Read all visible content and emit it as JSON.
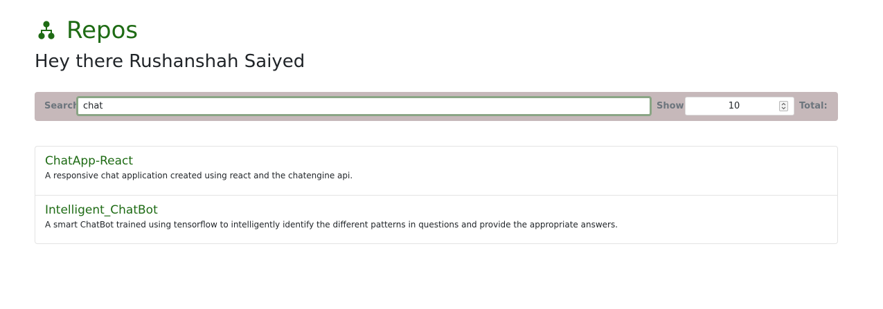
{
  "header": {
    "icon": "sitemap-icon",
    "title": "Repos",
    "greeting": "Hey there Rushanshah Saiyed"
  },
  "search_bar": {
    "search_label": "Search",
    "search_value": "chat",
    "show_label": "Show",
    "show_value": "10",
    "total_label": "Total:"
  },
  "repos": [
    {
      "name": "ChatApp-React",
      "description": "A responsive chat application created using react and the chatengine api."
    },
    {
      "name": "Intelligent_ChatBot",
      "description": "A smart ChatBot trained using tensorflow to intelligently identify the different patterns in questions and provide the appropriate answers."
    }
  ],
  "colors": {
    "accent_green": "#1e6b14",
    "search_bar_bg": "#c6b8ba",
    "input_focus_border": "#8aa585"
  }
}
